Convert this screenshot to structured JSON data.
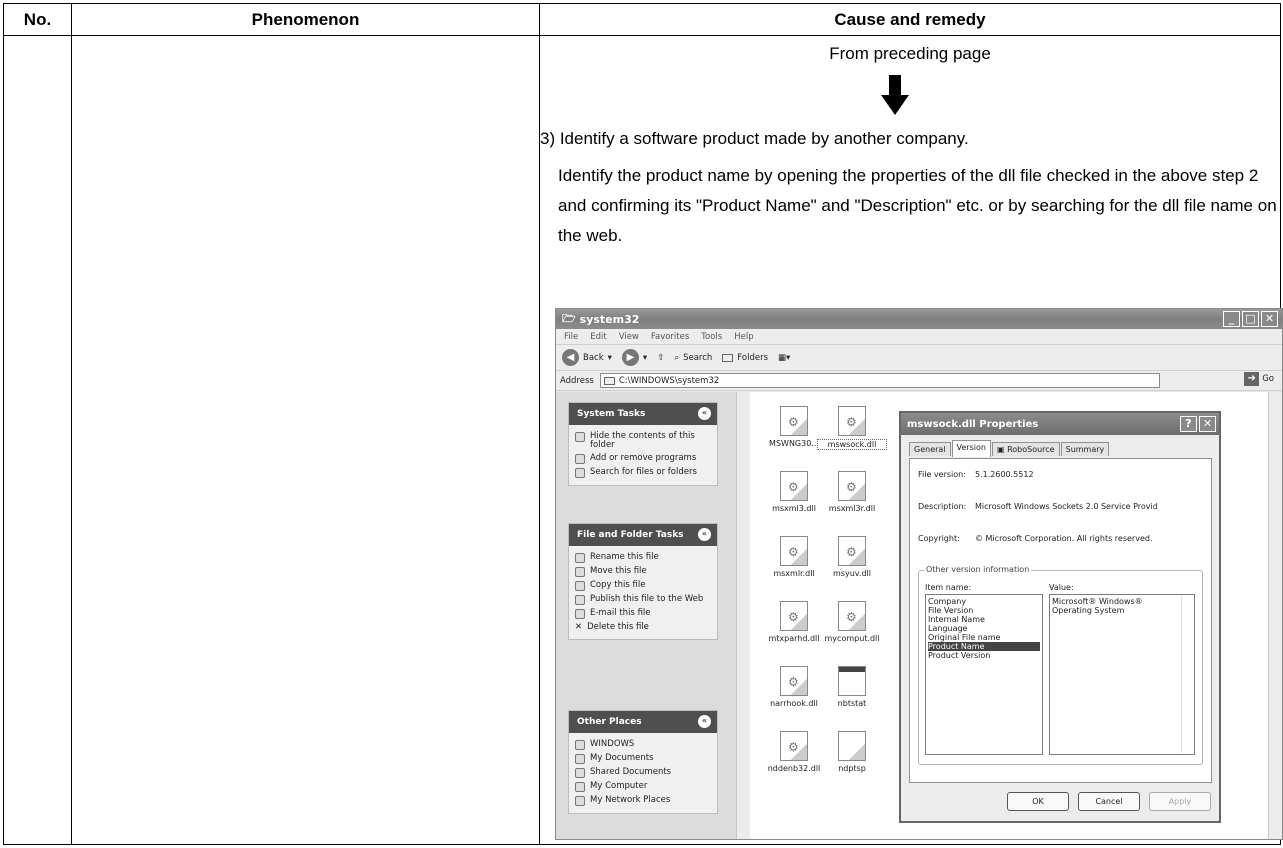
{
  "table": {
    "col_no": "No.",
    "col_phenomenon": "Phenomenon",
    "col_cause": "Cause and remedy"
  },
  "remedy": {
    "from_preceding": "From preceding page",
    "step3": "3) Identify a software product made by another company.",
    "detail": "Identify the product name by opening the properties of the dll file checked in the above step 2 and confirming its \"Product Name\" and \"Description\" etc. or by searching for the dll file name on the web."
  },
  "explorer": {
    "title": "system32",
    "menu": [
      "File",
      "Edit",
      "View",
      "Favorites",
      "Tools",
      "Help"
    ],
    "toolbar": {
      "back": "Back",
      "search": "Search",
      "folders": "Folders"
    },
    "address_label": "Address",
    "address_value": "C:\\WINDOWS\\system32",
    "go": "Go",
    "system_tasks": {
      "title": "System Tasks",
      "items": [
        "Hide the contents of this folder",
        "Add or remove programs",
        "Search for files or folders"
      ]
    },
    "file_tasks": {
      "title": "File and Folder Tasks",
      "items": [
        "Rename this file",
        "Move this file",
        "Copy this file",
        "Publish this file to the Web",
        "E-mail this file",
        "Delete this file"
      ]
    },
    "other_places": {
      "title": "Other Places",
      "items": [
        "WINDOWS",
        "My Documents",
        "Shared Documents",
        "My Computer",
        "My Network Places"
      ]
    },
    "files": [
      "MSWNG30...",
      "mswsock.dll",
      "msxml3.dll",
      "msxml3r.dll",
      "msxmlr.dll",
      "msyuv.dll",
      "mtxparhd.dll",
      "mycomput.dll",
      "narrhook.dll",
      "nbtstat",
      "nddenb32.dll",
      "ndptsp"
    ]
  },
  "dialog": {
    "title": "mswsock.dll Properties",
    "tabs": [
      "General",
      "Version",
      "RoboSource",
      "Summary"
    ],
    "file_version_label": "File version:",
    "file_version": "5.1.2600.5512",
    "description_label": "Description:",
    "description": "Microsoft Windows Sockets 2.0 Service Provid",
    "copyright_label": "Copyright:",
    "copyright": "© Microsoft Corporation. All rights reserved.",
    "other_info": "Other version information",
    "item_name_label": "Item name:",
    "value_label": "Value:",
    "items": [
      "Company",
      "File Version",
      "Internal Name",
      "Language",
      "Original File name",
      "Product Name",
      "Product Version"
    ],
    "selected_item": "Product Name",
    "value": "Microsoft® Windows® Operating System",
    "ok": "OK",
    "cancel": "Cancel",
    "apply": "Apply"
  }
}
